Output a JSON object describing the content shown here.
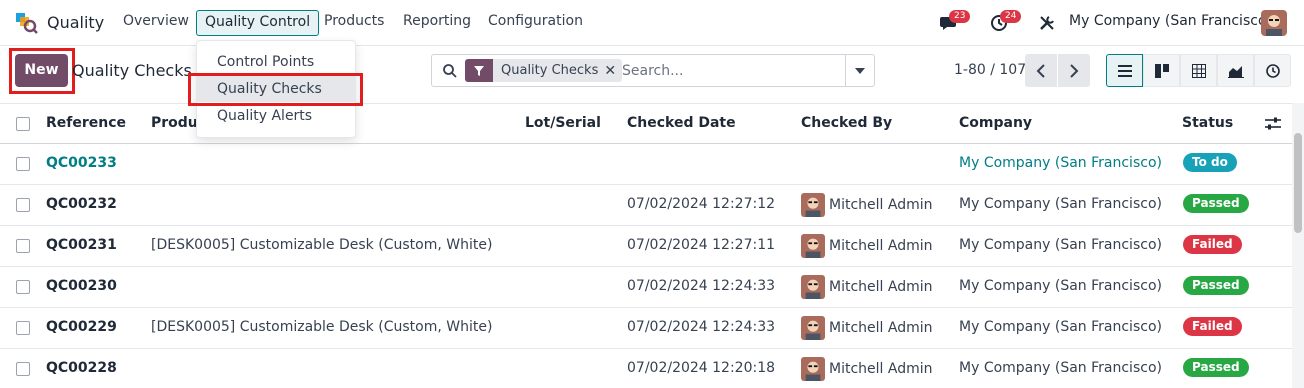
{
  "navbar": {
    "app_name": "Quality",
    "menu": [
      "Overview",
      "Quality Control",
      "Products",
      "Reporting",
      "Configuration"
    ],
    "messages_count": "23",
    "activities_count": "24",
    "company": "My Company (San Francisco)"
  },
  "dropdown": {
    "items": [
      "Control Points",
      "Quality Checks",
      "Quality Alerts"
    ]
  },
  "control_panel": {
    "new_label": "New",
    "title": "Quality Checks",
    "facet_label": "Quality Checks",
    "search_placeholder": "Search...",
    "pager": "1-80 / 107"
  },
  "table": {
    "headers": [
      "Reference",
      "Product",
      "Lot/Serial",
      "Checked Date",
      "Checked By",
      "Company",
      "Status"
    ],
    "rows": [
      {
        "ref": "QC00233",
        "product": "",
        "date": "",
        "by": "",
        "company": "My Company (San Francisco)",
        "status": "To do"
      },
      {
        "ref": "QC00232",
        "product": "",
        "date": "07/02/2024 12:27:12",
        "by": "Mitchell Admin",
        "company": "My Company (San Francisco)",
        "status": "Passed"
      },
      {
        "ref": "QC00231",
        "product": "[DESK0005] Customizable Desk (Custom, White)",
        "date": "07/02/2024 12:27:11",
        "by": "Mitchell Admin",
        "company": "My Company (San Francisco)",
        "status": "Failed"
      },
      {
        "ref": "QC00230",
        "product": "",
        "date": "07/02/2024 12:24:33",
        "by": "Mitchell Admin",
        "company": "My Company (San Francisco)",
        "status": "Passed"
      },
      {
        "ref": "QC00229",
        "product": "[DESK0005] Customizable Desk (Custom, White)",
        "date": "07/02/2024 12:24:33",
        "by": "Mitchell Admin",
        "company": "My Company (San Francisco)",
        "status": "Failed"
      },
      {
        "ref": "QC00228",
        "product": "",
        "date": "07/02/2024 12:20:18",
        "by": "Mitchell Admin",
        "company": "My Company (San Francisco)",
        "status": "Passed"
      }
    ]
  },
  "colors": {
    "primary": "#714b67",
    "link": "#017e84",
    "todo": "#17a2b8",
    "passed": "#28a745",
    "failed": "#dc3545",
    "annotation": "#e11d1d"
  },
  "icons": [
    "app-logo-icon",
    "chat-icon",
    "clock-icon",
    "tools-icon",
    "search-icon",
    "filter-icon",
    "caret-down-icon",
    "chevron-left-icon",
    "chevron-right-icon",
    "list-view-icon",
    "kanban-view-icon",
    "pivot-view-icon",
    "graph-view-icon",
    "activity-view-icon",
    "optional-columns-icon",
    "gear-icon"
  ]
}
